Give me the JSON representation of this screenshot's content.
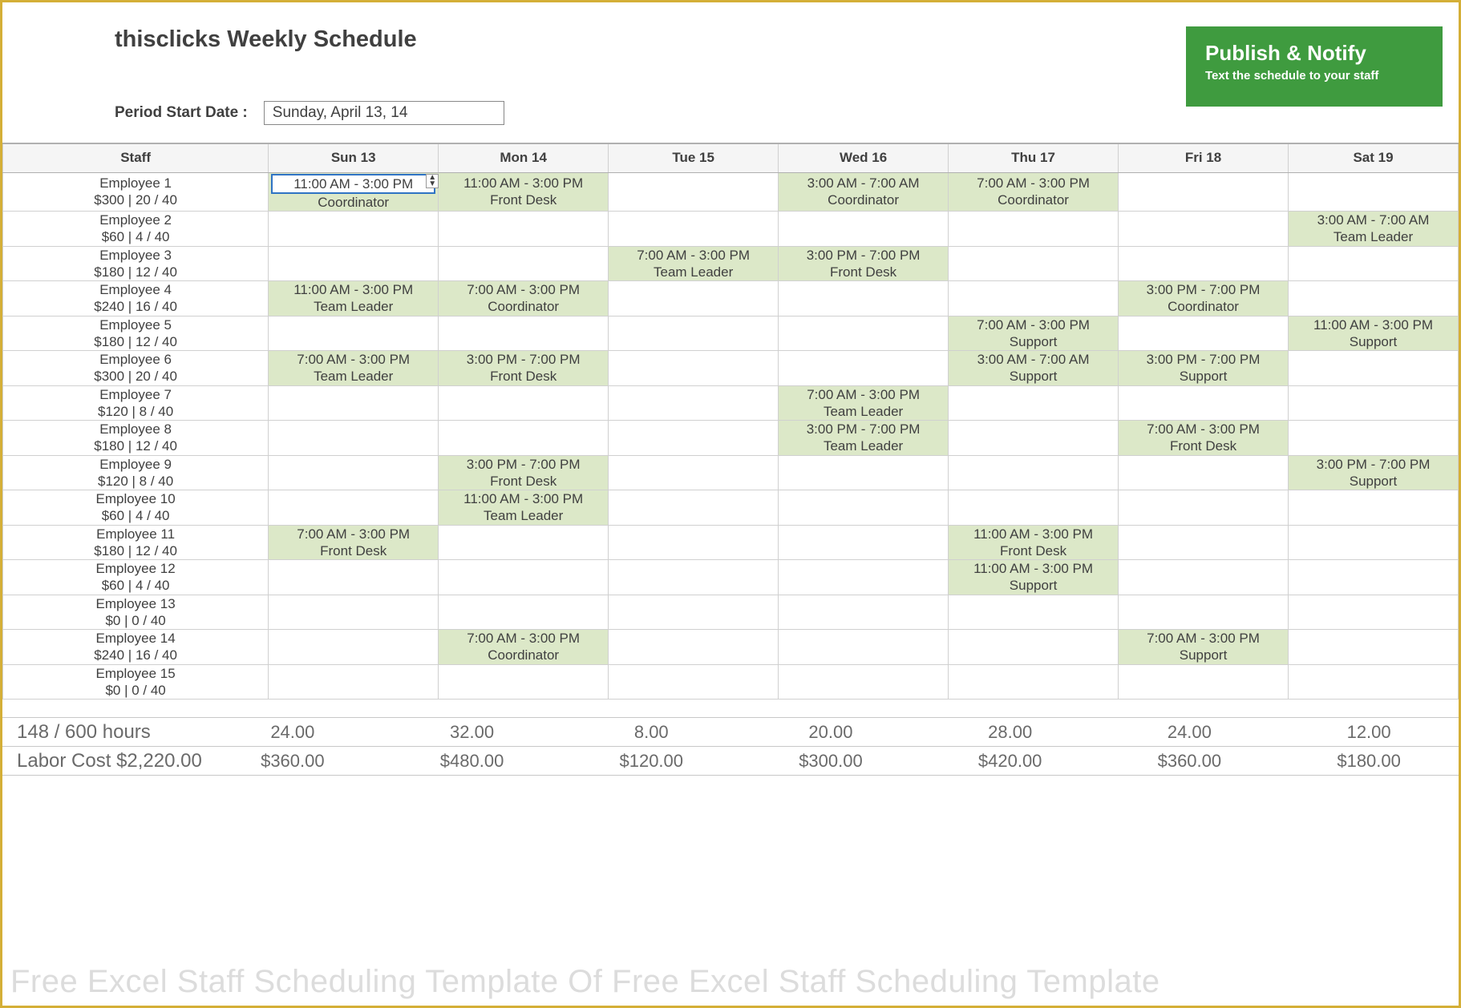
{
  "title": "thisclicks Weekly Schedule",
  "period_label": "Period Start Date :",
  "period_value": "Sunday, April 13, 14",
  "publish": {
    "title": "Publish & Notify",
    "sub": "Text the schedule to your staff"
  },
  "days": [
    "Staff",
    "Sun 13",
    "Mon 14",
    "Tue 15",
    "Wed 16",
    "Thu 17",
    "Fri 18",
    "Sat 19"
  ],
  "staff": [
    {
      "name": "Employee 1",
      "info": "$300 | 20 / 40",
      "shifts": [
        {
          "d": 0,
          "t": "11:00 AM - 3:00 PM",
          "r": "Coordinator",
          "active": true
        },
        {
          "d": 1,
          "t": "11:00 AM - 3:00 PM",
          "r": "Front Desk"
        },
        {
          "d": 3,
          "t": "3:00 AM - 7:00 AM",
          "r": "Coordinator"
        },
        {
          "d": 4,
          "t": "7:00 AM - 3:00 PM",
          "r": "Coordinator"
        }
      ]
    },
    {
      "name": "Employee 2",
      "info": "$60 | 4 / 40",
      "shifts": [
        {
          "d": 6,
          "t": "3:00 AM - 7:00 AM",
          "r": "Team Leader"
        }
      ]
    },
    {
      "name": "Employee 3",
      "info": "$180 | 12 / 40",
      "shifts": [
        {
          "d": 2,
          "t": "7:00 AM - 3:00 PM",
          "r": "Team Leader"
        },
        {
          "d": 3,
          "t": "3:00 PM - 7:00 PM",
          "r": "Front Desk"
        }
      ]
    },
    {
      "name": "Employee 4",
      "info": "$240 | 16 / 40",
      "shifts": [
        {
          "d": 0,
          "t": "11:00 AM - 3:00 PM",
          "r": "Team Leader"
        },
        {
          "d": 1,
          "t": "7:00 AM - 3:00 PM",
          "r": "Coordinator"
        },
        {
          "d": 5,
          "t": "3:00 PM - 7:00 PM",
          "r": "Coordinator"
        }
      ]
    },
    {
      "name": "Employee 5",
      "info": "$180 | 12 / 40",
      "shifts": [
        {
          "d": 4,
          "t": "7:00 AM - 3:00 PM",
          "r": "Support"
        },
        {
          "d": 6,
          "t": "11:00 AM - 3:00 PM",
          "r": "Support"
        }
      ]
    },
    {
      "name": "Employee 6",
      "info": "$300 | 20 / 40",
      "shifts": [
        {
          "d": 0,
          "t": "7:00 AM - 3:00 PM",
          "r": "Team Leader"
        },
        {
          "d": 1,
          "t": "3:00 PM - 7:00 PM",
          "r": "Front Desk"
        },
        {
          "d": 4,
          "t": "3:00 AM - 7:00 AM",
          "r": "Support"
        },
        {
          "d": 5,
          "t": "3:00 PM - 7:00 PM",
          "r": "Support"
        }
      ]
    },
    {
      "name": "Employee 7",
      "info": "$120 | 8 / 40",
      "shifts": [
        {
          "d": 3,
          "t": "7:00 AM - 3:00 PM",
          "r": "Team Leader"
        }
      ]
    },
    {
      "name": "Employee 8",
      "info": "$180 | 12 / 40",
      "shifts": [
        {
          "d": 3,
          "t": "3:00 PM - 7:00 PM",
          "r": "Team Leader"
        },
        {
          "d": 5,
          "t": "7:00 AM - 3:00 PM",
          "r": "Front Desk"
        }
      ]
    },
    {
      "name": "Employee 9",
      "info": "$120 | 8 / 40",
      "shifts": [
        {
          "d": 1,
          "t": "3:00 PM - 7:00 PM",
          "r": "Front Desk"
        },
        {
          "d": 6,
          "t": "3:00 PM - 7:00 PM",
          "r": "Support"
        }
      ]
    },
    {
      "name": "Employee 10",
      "info": "$60 | 4 / 40",
      "shifts": [
        {
          "d": 1,
          "t": "11:00 AM - 3:00 PM",
          "r": "Team Leader"
        }
      ]
    },
    {
      "name": "Employee 11",
      "info": "$180 | 12 / 40",
      "shifts": [
        {
          "d": 0,
          "t": "7:00 AM - 3:00 PM",
          "r": "Front Desk"
        },
        {
          "d": 4,
          "t": "11:00 AM - 3:00 PM",
          "r": "Front Desk"
        }
      ]
    },
    {
      "name": "Employee 12",
      "info": "$60 | 4 / 40",
      "shifts": [
        {
          "d": 4,
          "t": "11:00 AM - 3:00 PM",
          "r": "Support"
        }
      ]
    },
    {
      "name": "Employee 13",
      "info": "$0 | 0 / 40",
      "shifts": []
    },
    {
      "name": "Employee 14",
      "info": "$240 | 16 / 40",
      "shifts": [
        {
          "d": 1,
          "t": "7:00 AM - 3:00 PM",
          "r": "Coordinator"
        },
        {
          "d": 5,
          "t": "7:00 AM - 3:00 PM",
          "r": "Support"
        }
      ]
    },
    {
      "name": "Employee 15",
      "info": "$0 | 0 / 40",
      "shifts": []
    }
  ],
  "footer": {
    "hours_label": "148 / 600 hours",
    "hours": [
      "24.00",
      "32.00",
      "8.00",
      "20.00",
      "28.00",
      "24.00",
      "12.00"
    ],
    "cost_label": "Labor Cost $2,220.00",
    "costs": [
      "$360.00",
      "$480.00",
      "$120.00",
      "$300.00",
      "$420.00",
      "$360.00",
      "$180.00"
    ]
  },
  "watermark": "Free Excel Staff Scheduling Template Of Free Excel Staff Scheduling Template"
}
